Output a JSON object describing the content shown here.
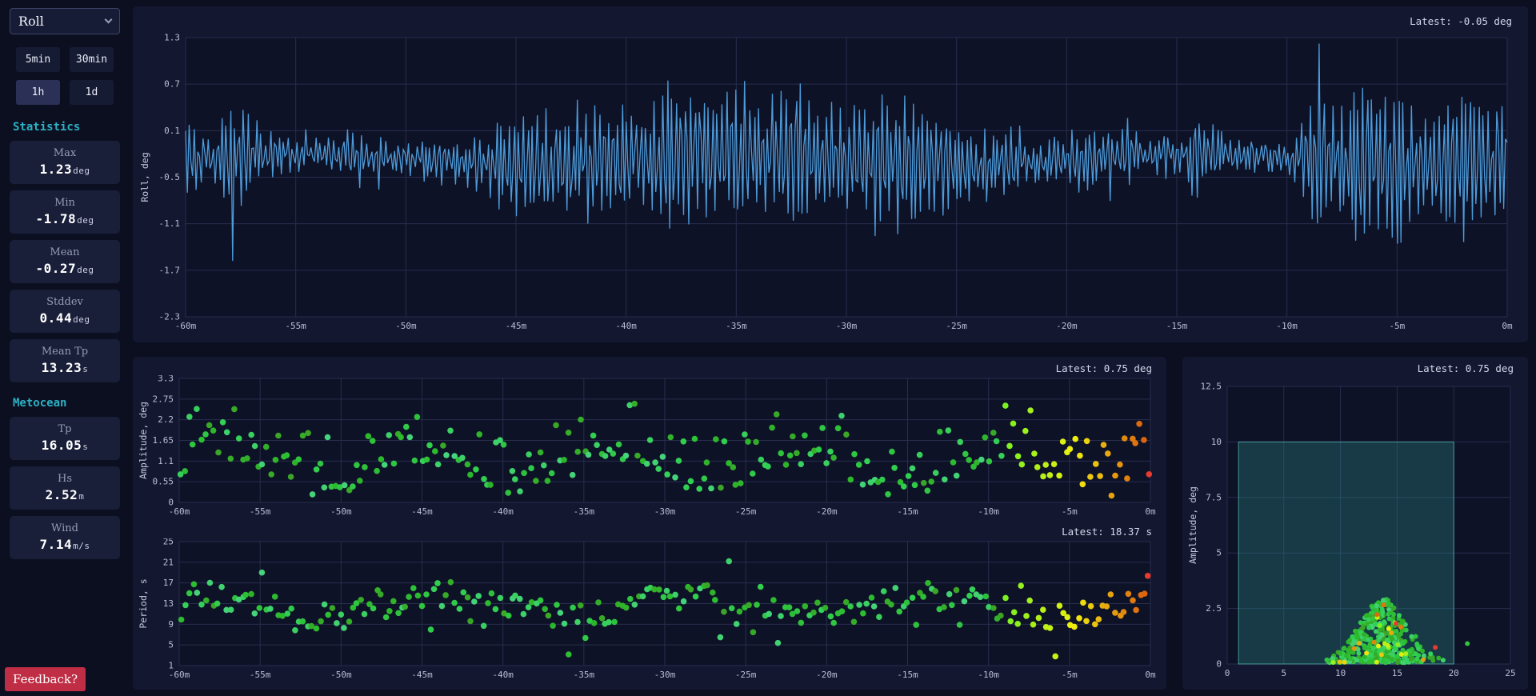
{
  "colors": {
    "accent_teal": "#2cb1c4",
    "line_blue": "#4d9bd9",
    "feedback_red": "#bf2e45",
    "point_green": "#3dbb4e",
    "point_yellow": "#f2d93b",
    "point_orange": "#f59b2d",
    "point_red": "#e63b2e",
    "region_teal": "#2b9d92"
  },
  "sidebar": {
    "channel_select": {
      "value": "Roll"
    },
    "range_buttons": [
      {
        "label": "5min",
        "active": false
      },
      {
        "label": "30min",
        "active": false
      },
      {
        "label": "1h",
        "active": true
      },
      {
        "label": "1d",
        "active": false
      }
    ],
    "statistics": {
      "heading": "Statistics",
      "items": [
        {
          "label": "Max",
          "value": "1.23",
          "unit": "deg"
        },
        {
          "label": "Min",
          "value": "-1.78",
          "unit": "deg"
        },
        {
          "label": "Mean",
          "value": "-0.27",
          "unit": "deg"
        },
        {
          "label": "Stddev",
          "value": "0.44",
          "unit": "deg"
        },
        {
          "label": "Mean Tp",
          "value": "13.23",
          "unit": "s"
        }
      ]
    },
    "metocean": {
      "heading": "Metocean",
      "items": [
        {
          "label": "Tp",
          "value": "16.05",
          "unit": "s"
        },
        {
          "label": "Hs",
          "value": "2.52",
          "unit": "m"
        },
        {
          "label": "Wind",
          "value": "7.14",
          "unit": "m/s"
        }
      ]
    },
    "feedback_label": "Feedback?"
  },
  "chart_data": [
    {
      "id": "roll_timeseries",
      "type": "line",
      "latest_label": "Latest: -0.05 deg",
      "latest_value": -0.05,
      "ylabel": "Roll, deg",
      "ylim": [
        -2.3,
        1.3
      ],
      "yticks": [
        1.3,
        0.7,
        0.1,
        -0.5,
        -1.1,
        -1.7,
        -2.3
      ],
      "xlim": [
        -60,
        0
      ],
      "xticks": [
        -60,
        -55,
        -50,
        -45,
        -40,
        -35,
        -30,
        -25,
        -20,
        -15,
        -10,
        -5,
        0
      ],
      "xtick_labels": [
        "-60m",
        "-55m",
        "-50m",
        "-45m",
        "-40m",
        "-35m",
        "-30m",
        "-25m",
        "-20m",
        "-15m",
        "-10m",
        "-5m",
        "0m"
      ],
      "stats": {
        "max": 1.23,
        "min": -1.78,
        "mean": -0.27,
        "stddev": 0.44
      },
      "line_color": "#4d9bd9",
      "grid": true,
      "legend": "none",
      "gen": {
        "kind": "roll",
        "seed": 11,
        "n": 760
      }
    },
    {
      "id": "amplitude_scatter",
      "type": "scatter",
      "latest_label": "Latest: 0.75 deg",
      "latest_value": 0.75,
      "ylabel": "Amplitude, deg",
      "ylim": [
        0,
        3.3
      ],
      "yticks": [
        0,
        0.55,
        1.1,
        1.65,
        2.2,
        2.75,
        3.3
      ],
      "xlim": [
        -60,
        0
      ],
      "xticks": [
        -60,
        -55,
        -50,
        -45,
        -40,
        -35,
        -30,
        -25,
        -20,
        -15,
        -10,
        -5,
        0
      ],
      "xtick_labels": [
        "-60m",
        "-55m",
        "-50m",
        "-45m",
        "-40m",
        "-35m",
        "-30m",
        "-25m",
        "-20m",
        "-15m",
        "-10m",
        "-5m",
        "0m"
      ],
      "grid": true,
      "legend": "none",
      "color_encoding": "age: old=green, recent=yellow/orange, latest=red",
      "gen": {
        "kind": "amp",
        "seed": 23,
        "n": 238,
        "split": 0.85,
        "r": 3.8
      }
    },
    {
      "id": "period_scatter",
      "type": "scatter",
      "latest_label": "Latest: 18.37 s",
      "latest_value": 18.37,
      "ylabel": "Period, s",
      "ylim": [
        1,
        25
      ],
      "yticks": [
        1,
        5,
        9,
        13,
        17,
        21,
        25
      ],
      "xlim": [
        -60,
        0
      ],
      "xticks": [
        -60,
        -55,
        -50,
        -45,
        -40,
        -35,
        -30,
        -25,
        -20,
        -15,
        -10,
        -5,
        0
      ],
      "xtick_labels": [
        "-60m",
        "-55m",
        "-50m",
        "-45m",
        "-40m",
        "-35m",
        "-30m",
        "-25m",
        "-20m",
        "-15m",
        "-10m",
        "-5m",
        "0m"
      ],
      "grid": true,
      "legend": "none",
      "color_encoding": "age: old=green, recent=yellow/orange, latest=red",
      "gen": {
        "kind": "per",
        "seed": 37,
        "n": 238,
        "split": 0.85,
        "r": 3.8
      }
    },
    {
      "id": "amplitude_vs_period",
      "type": "scatter",
      "latest_label": "Latest: 0.75 deg",
      "ylabel": "Amplitude, deg",
      "ylim": [
        0,
        12.5
      ],
      "yticks": [
        0,
        2.5,
        5,
        7.5,
        10,
        12.5
      ],
      "xlim": [
        0,
        25
      ],
      "xticks": [
        0,
        5,
        10,
        15,
        20,
        25
      ],
      "grid": true,
      "legend": "none",
      "region": {
        "x0": 1,
        "x1": 20,
        "y0": 0,
        "y1": 10,
        "fill": "rgba(45,160,150,0.28)",
        "stroke": "rgba(90,205,195,0.65)"
      },
      "latest_point": {
        "x": 18.37,
        "y": 0.75
      },
      "extra_points": [
        {
          "x": 21.2,
          "y": 0.92,
          "t": 0.9
        }
      ],
      "color_encoding": "age: old=green, recent=yellow/orange, latest=red",
      "gen": {
        "kind": "blob",
        "seed": 51,
        "n": 430,
        "split": 0.94,
        "r": 3.0
      }
    }
  ]
}
